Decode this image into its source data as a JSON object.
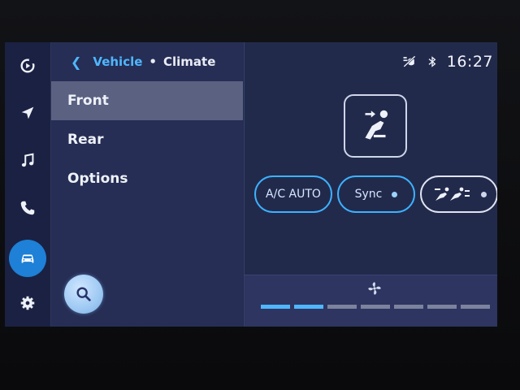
{
  "breadcrumb": {
    "back_icon": "chevron-left-icon",
    "parent": "Vehicle",
    "separator": "•",
    "current": "Climate"
  },
  "menu": {
    "items": [
      {
        "label": "Front",
        "selected": true
      },
      {
        "label": "Rear",
        "selected": false
      },
      {
        "label": "Options",
        "selected": false
      }
    ],
    "search_icon": "search-icon"
  },
  "rail": {
    "items": [
      {
        "icon": "media-icon"
      },
      {
        "icon": "navigation-icon"
      },
      {
        "icon": "music-icon"
      },
      {
        "icon": "phone-icon"
      },
      {
        "icon": "car-icon",
        "active": true
      },
      {
        "icon": "settings-icon"
      }
    ]
  },
  "status": {
    "icons": [
      "voice-off-icon",
      "bluetooth-icon"
    ],
    "clock": "16:27"
  },
  "climate": {
    "airflow_icon": "airflow-face-icon",
    "buttons": [
      {
        "label": "A/C AUTO"
      },
      {
        "label": "Sync",
        "indicator": true
      },
      {
        "icon": "airflow-modes-icon",
        "indicator": true
      }
    ],
    "fan": {
      "icon": "fan-icon",
      "level": 2,
      "segments": 7
    }
  },
  "colors": {
    "accent": "#3db2ff",
    "active_rail": "#1e80d6",
    "fan_active": "#4fb7ff",
    "fan_inactive": "#7c839e"
  }
}
